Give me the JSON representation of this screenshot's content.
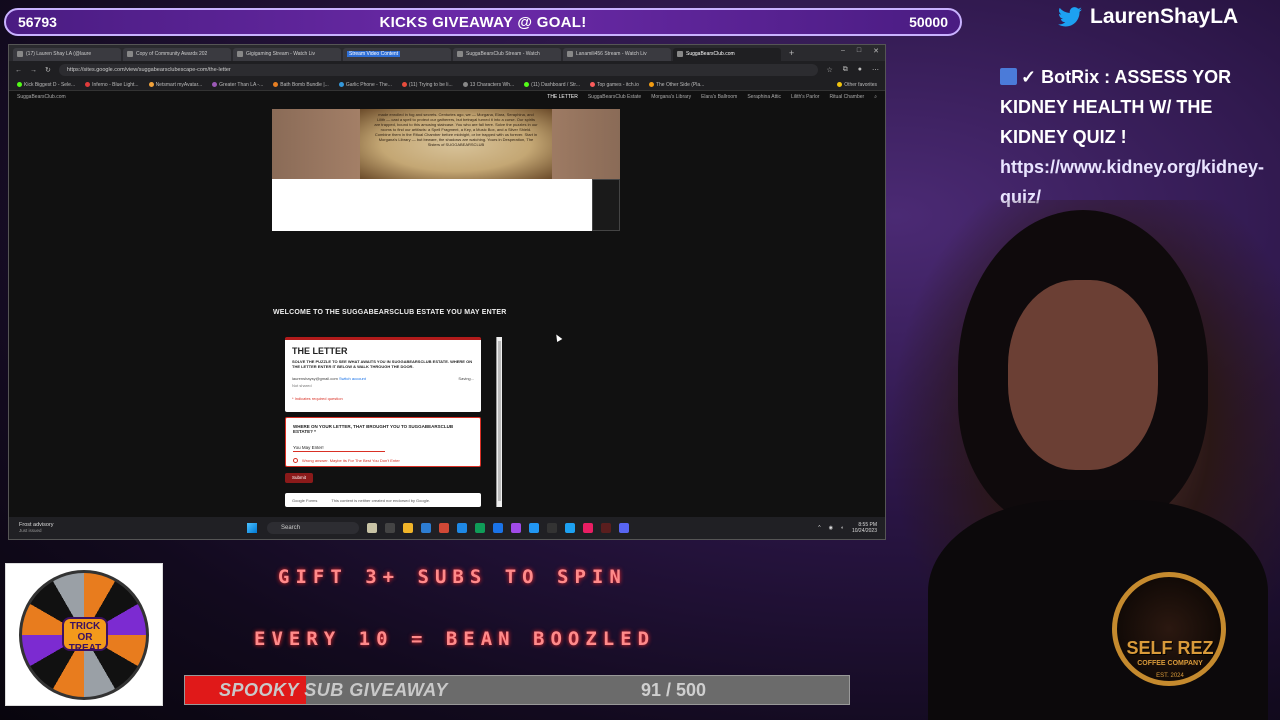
{
  "goal": {
    "current": "56793",
    "title": "KICKS GIVEAWAY @ GOAL!",
    "target": "50000"
  },
  "twitter": {
    "handle": "LaurenShayLA"
  },
  "chat": {
    "user": "BotRix",
    "message": "ASSESS YOR KIDNEY HEALTH W/ THE KIDNEY QUIZ !",
    "link": "https://www.kidney.org/kidney-quiz/"
  },
  "browser": {
    "tabs": [
      "(17) Lauren Shay LA (@laure",
      "Copy of Community Awards 202",
      "Gigigaming Stream - Watch Liv",
      "Stream Video Content",
      "SuggaBearsClub Stream - Watch",
      "Lanamili456 Stream - Watch Liv",
      "SuggaBearsClub.com"
    ],
    "url": "https://sites.google.com/view/suggabearsclubescape-com/the-letter",
    "bookmarks": [
      "Kick Biggest D - Sele...",
      "Inferno - Blue Light...",
      "Netsmart myAvatar...",
      "Greater Than LA -...",
      "Bath Bomb Bundle |...",
      "Garlic Phone - The...",
      "(11) Trying to be li...",
      "13 Characters Wh...",
      "(11) Dashboard / Str...",
      "Top games - itch.io",
      "The Other Side (Pla...",
      "Other favorites"
    ]
  },
  "site": {
    "name": "SuggaBearsClub.com",
    "nav": [
      "THE LETTER",
      "SuggaBearsClub Estate",
      "Morgana's Library",
      "Elara's Ballroom",
      "Seraphina Attic",
      "Lilith's Parlor",
      "Ritual Chamber"
    ],
    "parchment_text": "made enrolled in fog and secrets. Centuries ago, we — Morgana, Elara, Seraphina, and Lilith — cast a spell to protect our gatherers, but betrayal turned it into a curse. Our spirits are trapped, bound to this amusing staircase. You who are fall here. Solve the puzzles in our rooms to find our artifacts: a Spell Fragment, a Key, a Music Box, and a Silver Shield. Combine them in the Ritual Chamber before midnight, or be trapped with us forever. Start in Morgana's Library — but beware, the shadows are watching. Yours in Desperation, The Sisters of SUGGABEARSCLUB",
    "welcome": "WELCOME TO THE SUGGABEARSCLUB ESTATE YOU MAY ENTER"
  },
  "form": {
    "title": "THE LETTER",
    "description": "SOLVE THE PUZZLE TO SEE WHAT AWAITS YOU IN SUGGABEARSCLUB ESTATE. WHERE ON THE LETTER ENTER IT BELOW & WALK THROUGH THE DOOR.",
    "account_email": "laurenshaysy@gmail.com",
    "switch_account": "Switch account",
    "not_shared": "Not shared",
    "saving": "Saving...",
    "required_note": "* Indicates required question",
    "question": "WHERE ON YOUR LETTER, THAT BROUGHT YOU TO SUGGABEARSCLUB ESTATE? *",
    "answer": "You May Enter!",
    "error": "Wrong answer. Maybe its For The Best You Don't Enter",
    "submit": "Submit",
    "footer_brand": "Google Forms",
    "footer_note": "This content is neither created nor endorsed by Google."
  },
  "taskbar": {
    "weather_title": "Frost advisory",
    "weather_sub": "Just issued",
    "search_placeholder": "Search",
    "time": "8:55 PM",
    "date": "10/24/2023"
  },
  "overlay": {
    "gift_line": "GIFT 3+ SUBS TO SPIN",
    "every_line": "EVERY 10 = BEAN BOOZLED",
    "wheel_center": "TRICK OR TREAT",
    "sub_label": "SPOOKY SUB GIVEAWAY",
    "sub_count": "91 / 500",
    "sub_progress": 0.182,
    "coffee_name": "SELF REZ",
    "coffee_sub": "COFFEE COMPANY",
    "coffee_est": "EST. 2024"
  },
  "colors": {
    "goal_bar": "#6b2aa8",
    "sub_fill": "#e01919",
    "brand_red": "#b21b1b",
    "coffee_gold": "#d99a3a"
  }
}
